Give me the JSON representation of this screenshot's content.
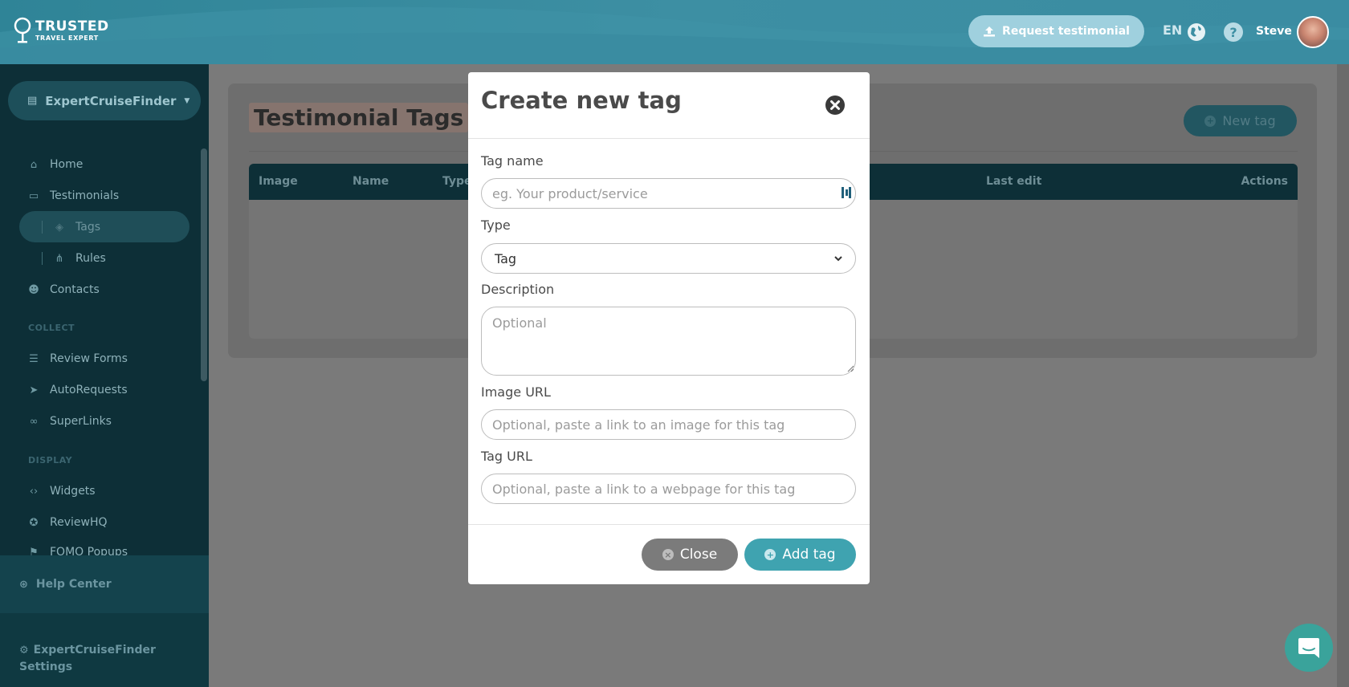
{
  "header": {
    "logo_line1": "TRUSTED",
    "logo_line2": "TRAVEL EXPERT",
    "request_button": "Request testimonial",
    "language": "EN",
    "help_label": "?",
    "user_name": "Steve"
  },
  "sidebar": {
    "workspace": "ExpertCruiseFinder",
    "items": [
      {
        "label": "Home",
        "icon": "home-icon"
      },
      {
        "label": "Testimonials",
        "icon": "testimonials-icon"
      },
      {
        "label": "Tags",
        "icon": "tag-icon"
      },
      {
        "label": "Rules",
        "icon": "sitemap-icon"
      },
      {
        "label": "Contacts",
        "icon": "users-icon"
      }
    ],
    "section_collect": "COLLECT",
    "collect_items": [
      {
        "label": "Review Forms",
        "icon": "list-icon"
      },
      {
        "label": "AutoRequests",
        "icon": "paper-plane-icon"
      },
      {
        "label": "SuperLinks",
        "icon": "link-icon"
      }
    ],
    "section_display": "DISPLAY",
    "display_items": [
      {
        "label": "Widgets",
        "icon": "code-icon"
      },
      {
        "label": "ReviewHQ",
        "icon": "star-icon"
      },
      {
        "label": "FOMO Popups",
        "icon": "flag-icon"
      }
    ],
    "help_center": "Help Center",
    "settings": "ExpertCruiseFinder Settings"
  },
  "main": {
    "title": "Testimonial Tags",
    "new_tag_button": "New tag",
    "table_columns": [
      "Image",
      "Name",
      "Type",
      "Last edit",
      "Actions"
    ]
  },
  "modal": {
    "title": "Create new tag",
    "tag_name_label": "Tag name",
    "tag_name_placeholder": "eg. Your product/service",
    "type_label": "Type",
    "type_value": "Tag",
    "description_label": "Description",
    "description_placeholder": "Optional",
    "image_url_label": "Image URL",
    "image_url_placeholder": "Optional, paste a link to an image for this tag",
    "tag_url_label": "Tag URL",
    "tag_url_placeholder": "Optional, paste a link to a webpage for this tag",
    "close_button": "Close",
    "add_button": "Add tag"
  },
  "colors": {
    "brand_teal": "#3d8fa3",
    "sidebar_dark": "#0d2f37",
    "add_button": "#3fa3b0",
    "chat_launcher": "#3aa39b"
  }
}
